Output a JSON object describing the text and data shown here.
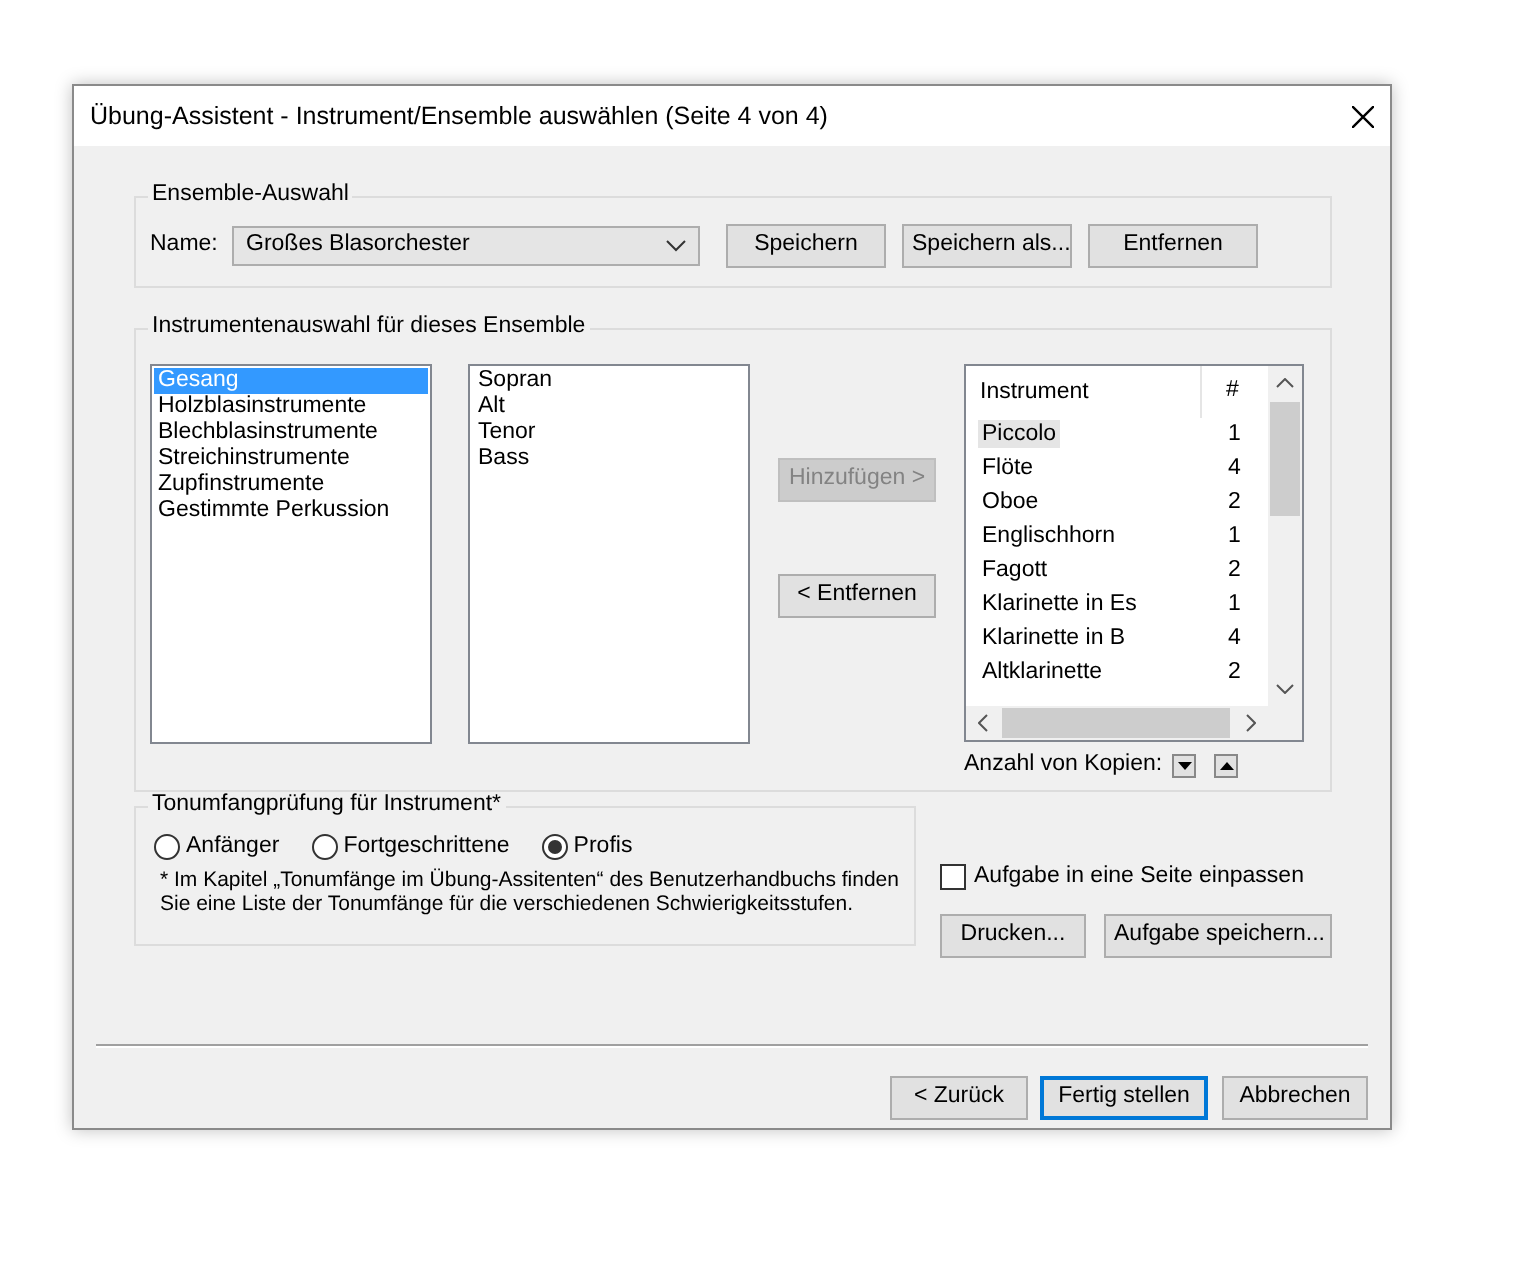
{
  "window": {
    "title": "Übung-Assistent - Instrument/Ensemble auswählen (Seite 4 von 4)"
  },
  "ensemble_group": {
    "title": "Ensemble-Auswahl",
    "name_label": "Name:",
    "name_value": "Großes Blasorchester",
    "buttons": [
      "Speichern",
      "Speichern als...",
      "Entfernen"
    ]
  },
  "instrument_group": {
    "title": "Instrumentenauswahl für dieses Ensemble",
    "families": [
      {
        "label": "Gesang",
        "selected": true
      },
      {
        "label": "Holzblasinstrumente",
        "selected": false
      },
      {
        "label": "Blechblasinstrumente",
        "selected": false
      },
      {
        "label": "Streichinstrumente",
        "selected": false
      },
      {
        "label": "Zupfinstrumente",
        "selected": false
      },
      {
        "label": "Gestimmte Perkussion",
        "selected": false
      }
    ],
    "instruments": [
      {
        "label": "Sopran",
        "selected": false
      },
      {
        "label": "Alt",
        "selected": false
      },
      {
        "label": "Tenor",
        "selected": false
      },
      {
        "label": "Bass",
        "selected": false
      }
    ],
    "add_button": {
      "label": "Hinzufügen >",
      "disabled": true
    },
    "remove_button": {
      "label": "< Entfernen",
      "disabled": false
    },
    "ensemble_list": {
      "columns": [
        "Instrument",
        "#"
      ],
      "rows": [
        {
          "instrument": "Piccolo",
          "count": "1",
          "selected": true
        },
        {
          "instrument": "Flöte",
          "count": "4",
          "selected": false
        },
        {
          "instrument": "Oboe",
          "count": "2",
          "selected": false
        },
        {
          "instrument": "Englischhorn",
          "count": "1",
          "selected": false
        },
        {
          "instrument": "Fagott",
          "count": "2",
          "selected": false
        },
        {
          "instrument": "Klarinette in Es",
          "count": "1",
          "selected": false
        },
        {
          "instrument": "Klarinette in B",
          "count": "4",
          "selected": false
        },
        {
          "instrument": "Altklarinette",
          "count": "2",
          "selected": false
        }
      ]
    },
    "copies_label": "Anzahl von Kopien:"
  },
  "range_group": {
    "title": "Tonumfangprüfung für Instrument*",
    "options": [
      {
        "label": "Anfänger",
        "selected": false
      },
      {
        "label": "Fortgeschrittene",
        "selected": false
      },
      {
        "label": "Profis",
        "selected": true
      }
    ],
    "note": "* Im Kapitel „Tonumfänge im Übung-Assitenten“ des Benutzerhandbuchs finden Sie eine Liste der Tonumfänge für die verschiedenen Schwierigkeitsstufen."
  },
  "fit_checkbox": {
    "label": "Aufgabe in eine Seite einpassen",
    "checked": false
  },
  "print_button": "Drucken...",
  "save_button": "Aufgabe speichern...",
  "footer_buttons": [
    {
      "label": "< Zurück",
      "default": false
    },
    {
      "label": "Fertig stellen",
      "default": true
    },
    {
      "label": "Abbrechen",
      "default": false
    }
  ]
}
